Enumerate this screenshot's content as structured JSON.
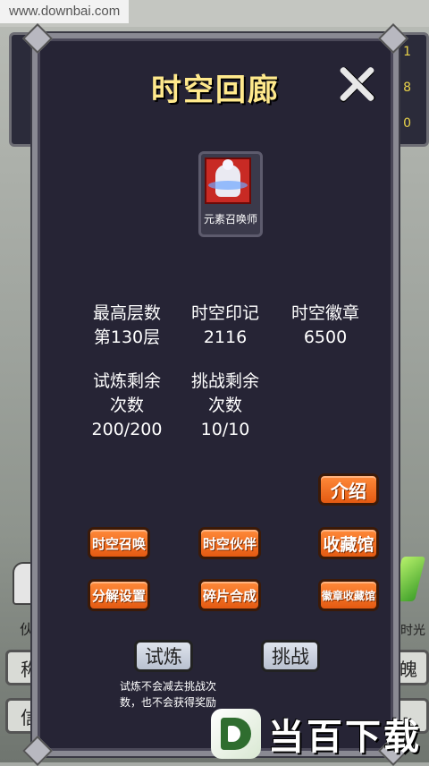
{
  "watermark": {
    "site": "www.downbai.com",
    "logo_text": "当百下载"
  },
  "background": {
    "numbers": [
      "1",
      "8",
      "0"
    ],
    "left_label": "伙",
    "right_label": "时光",
    "buttons": [
      "称",
      "信",
      "魄",
      ""
    ]
  },
  "modal": {
    "title": "时空回廊",
    "hero": {
      "name": "元素召唤师"
    },
    "stats": [
      {
        "label": "最高层数",
        "value": "第130层"
      },
      {
        "label": "时空印记",
        "value": "2116"
      },
      {
        "label": "时空徽章",
        "value": "6500"
      },
      {
        "label": "试炼剩余\n次数",
        "label_1": "试炼剩余",
        "label_2": "次数",
        "value": "200/200"
      },
      {
        "label_1": "挑战剩余",
        "label_2": "次数",
        "value": "10/10"
      }
    ],
    "buttons": {
      "intro": "介绍",
      "summon": "时空召唤",
      "partner": "时空伙伴",
      "collection": "收藏馆",
      "decompose": "分解设置",
      "fragment": "碎片合成",
      "badge_collection": "徽章收藏馆",
      "trial": "试炼",
      "challenge": "挑战"
    },
    "note_line1": "试炼不会减去挑战次",
    "note_line2": "数，也不会获得奖励"
  }
}
